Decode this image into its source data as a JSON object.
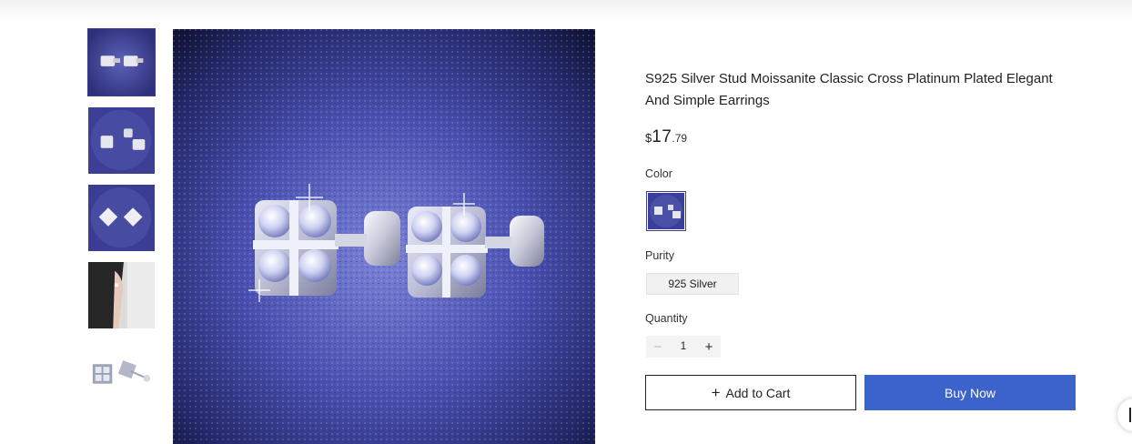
{
  "product": {
    "title": "S925 Silver Stud Moissanite Classic Cross Platinum Plated Elegant And Simple Earrings",
    "price": {
      "currency": "$",
      "whole": "17",
      "cents": ".79"
    }
  },
  "options": {
    "color_label": "Color",
    "purity_label": "Purity",
    "purity_value": "925 Silver",
    "quantity_label": "Quantity",
    "quantity_value": "1",
    "minus": "−",
    "plus": "+"
  },
  "actions": {
    "add_to_cart": "Add to Cart",
    "add_icon": "+",
    "buy_now": "Buy Now"
  },
  "gallery": {
    "thumbnails": [
      "earrings-front",
      "earrings-side",
      "earrings-top",
      "model-ear",
      "earrings-white-bg"
    ],
    "selected_index": 0
  },
  "colors": {
    "accent": "#3b63c9",
    "background_blue": "#3a3f9a"
  }
}
